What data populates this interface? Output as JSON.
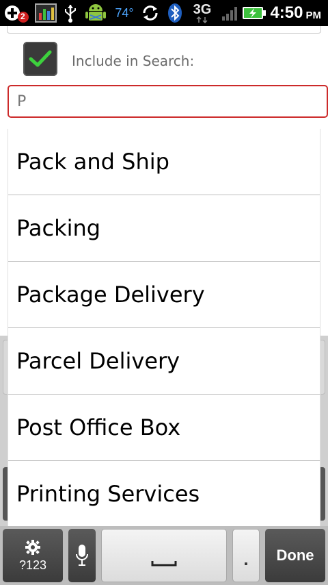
{
  "status_bar": {
    "notification_count": "2",
    "temperature": "74°",
    "network": "3G",
    "time": "4:50",
    "ampm": "PM"
  },
  "form": {
    "include_label": "Include in Search:",
    "search_value": "P",
    "checkbox_checked": true
  },
  "suggestions": [
    "Pack and Ship",
    "Packing",
    "Package Delivery",
    "Parcel Delivery",
    "Post Office Box",
    "Printing Services"
  ],
  "keyboard": {
    "symbols_label": "?123",
    "space_glyph": "␣",
    "period_label": ".",
    "done_label": "Done"
  },
  "colors": {
    "input_border": "#cc2a2a",
    "check_green": "#3dd13d",
    "temp_blue": "#4da6ff"
  }
}
